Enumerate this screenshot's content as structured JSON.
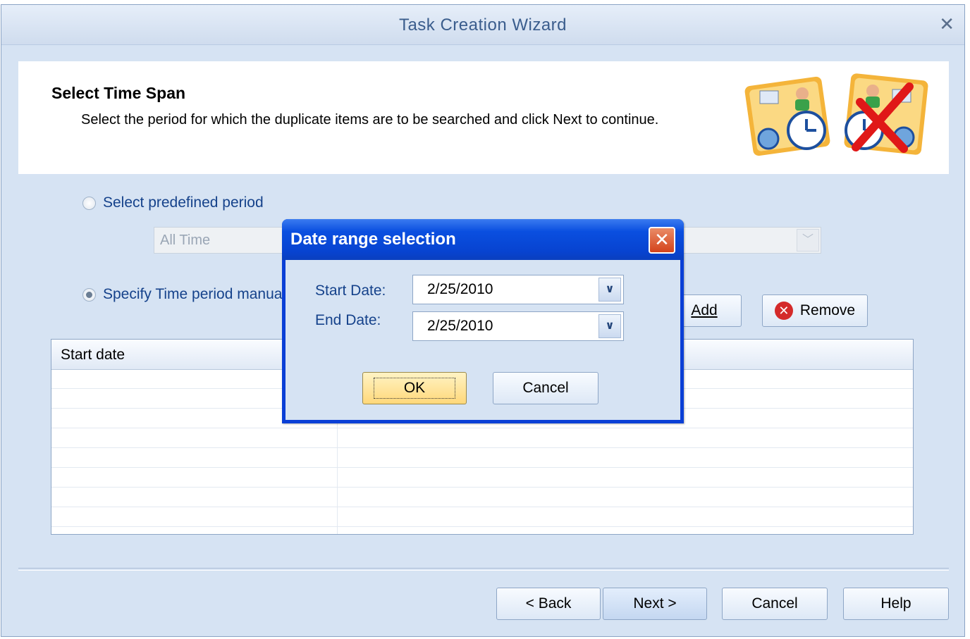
{
  "window": {
    "title": "Task Creation Wizard",
    "close_glyph": "✕"
  },
  "header": {
    "title": "Select Time Span",
    "description": "Select the period for which the duplicate items are to be searched and click Next to continue."
  },
  "options": {
    "predefined_label": "Select predefined period",
    "predefined_value": "All Time",
    "manual_label": "Specify Time period manua",
    "selected": "manual"
  },
  "list_buttons": {
    "add_label": "Add",
    "remove_label": "Remove"
  },
  "grid": {
    "columns": [
      "Start date"
    ],
    "rows": 8
  },
  "footer": {
    "back": "< Back",
    "next": "Next >",
    "cancel": "Cancel",
    "help": "Help"
  },
  "dialog": {
    "title": "Date range selection",
    "close_glyph": "✕",
    "start_label": "Start Date:",
    "start_value": "2/25/2010",
    "end_label": "End Date:",
    "end_value": "2/25/2010",
    "ok": "OK",
    "cancel": "Cancel"
  },
  "icons": [
    "close-icon",
    "remove-icon",
    "chevron-down-icon",
    "outlook-clock-icon",
    "outlook-clock-crossed-icon"
  ]
}
